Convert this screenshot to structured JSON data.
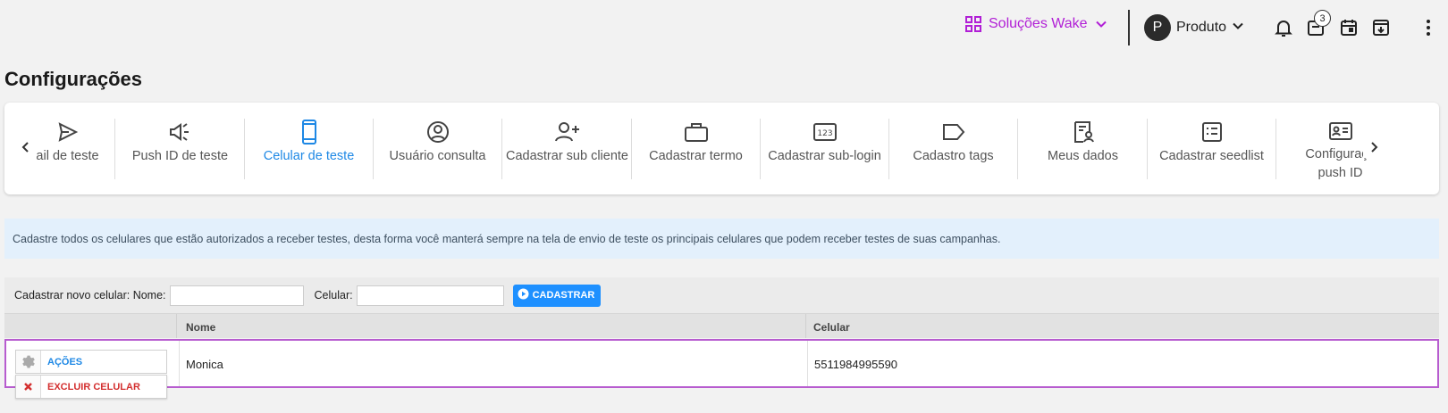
{
  "header": {
    "brand_label": "Soluções Wake",
    "user_initial": "P",
    "user_name": "Produto",
    "badge_count": "3",
    "brand_color": "#b11fd6"
  },
  "page": {
    "title": "Configurações"
  },
  "tabs": [
    {
      "label": "ail de teste",
      "icon": "send-icon"
    },
    {
      "label": "Push ID de teste",
      "icon": "megaphone-icon"
    },
    {
      "label": "Celular de teste",
      "icon": "smartphone-icon",
      "active": true
    },
    {
      "label": "Usuário consulta",
      "icon": "user-circle-icon"
    },
    {
      "label": "Cadastrar sub cliente",
      "icon": "add-user-icon"
    },
    {
      "label": "Cadastrar termo",
      "icon": "briefcase-icon"
    },
    {
      "label": "Cadastrar sub-login",
      "icon": "numeric-123-icon"
    },
    {
      "label": "Cadastro tags",
      "icon": "tag-icon"
    },
    {
      "label": "Meus dados",
      "icon": "user-document-icon"
    },
    {
      "label": "Cadastrar seedlist",
      "icon": "list-box-icon"
    },
    {
      "label": "Configuraçõ push ID",
      "icon": "contact-card-icon"
    }
  ],
  "info": {
    "text": "Cadastre todos os celulares que estão autorizados a receber testes, desta forma você manterá sempre na tela de envio de teste os principais celulares que podem receber testes de suas campanhas."
  },
  "form": {
    "name_label": "Cadastrar novo celular: Nome:",
    "name_value": "",
    "phone_label": "Celular:",
    "phone_value": "",
    "submit_label": "CADASTRAR"
  },
  "table": {
    "columns": [
      "",
      "Nome",
      "Celular"
    ],
    "rows": [
      {
        "nome": "Monica",
        "celular": "5511984995590"
      }
    ],
    "actions_label": "AÇÕES",
    "delete_label": "EXCLUIR CELULAR"
  }
}
